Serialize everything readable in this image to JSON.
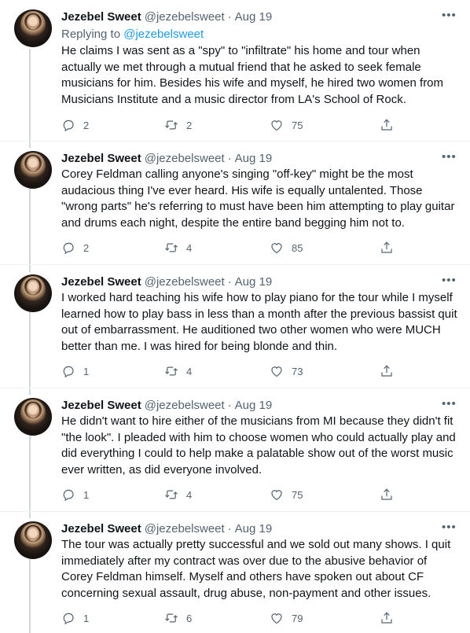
{
  "tweets": [
    {
      "name": "Jezebel Sweet",
      "handle": "@jezebelsweet",
      "dot": "·",
      "date": "Aug 19",
      "replying_prefix": "Replying to",
      "replying_handle": "@jezebelsweet",
      "text": "He claims I was sent as a \"spy\" to \"infiltrate\" his home and tour when actually we met through a mutual friend that he asked to seek female musicians for him. Besides his wife and myself, he hired two women from Musicians Institute and a music director from LA's School of Rock.",
      "replies": "2",
      "retweets": "2",
      "likes": "75"
    },
    {
      "name": "Jezebel Sweet",
      "handle": "@jezebelsweet",
      "dot": "·",
      "date": "Aug 19",
      "text": "Corey Feldman calling anyone's singing \"off-key\" might be the most audacious thing I've ever heard. His wife is equally untalented. Those \"wrong parts\" he's referring to must have been him attempting to play guitar and drums each night, despite the entire band begging him not to.",
      "replies": "2",
      "retweets": "4",
      "likes": "85"
    },
    {
      "name": "Jezebel Sweet",
      "handle": "@jezebelsweet",
      "dot": "·",
      "date": "Aug 19",
      "text": "I worked hard teaching his wife how to play piano for the tour while I myself learned how to play bass in less than a month after the previous bassist quit out of embarrassment. He auditioned two other women who were MUCH better than me. I was hired for being blonde and thin.",
      "replies": "1",
      "retweets": "4",
      "likes": "73"
    },
    {
      "name": "Jezebel Sweet",
      "handle": "@jezebelsweet",
      "dot": "·",
      "date": "Aug 19",
      "text": "He didn't want to hire either of the musicians from MI because they didn't fit \"the look\". I pleaded with him to choose women who could actually play and did everything I could to help make a palatable show out of the worst music ever written, as did everyone involved.",
      "replies": "1",
      "retweets": "4",
      "likes": "75"
    },
    {
      "name": "Jezebel Sweet",
      "handle": "@jezebelsweet",
      "dot": "·",
      "date": "Aug 19",
      "text": "The tour was actually pretty successful and we sold out many shows. I quit immediately after my contract was over due to the abusive behavior of Corey Feldman himself. Myself and others have spoken out about CF concerning sexual assault, drug abuse, non-payment and other issues.",
      "replies": "1",
      "retweets": "6",
      "likes": "79"
    }
  ],
  "icons": {
    "more": "more-horizontal-icon",
    "reply": "reply-bubble-icon",
    "retweet": "retweet-arrows-icon",
    "like": "heart-icon",
    "share": "share-upload-icon"
  },
  "colors": {
    "link": "#1d9bf0",
    "secondary_text": "#536471",
    "primary_text": "#0f1419",
    "thread_line": "#cfd9de"
  }
}
